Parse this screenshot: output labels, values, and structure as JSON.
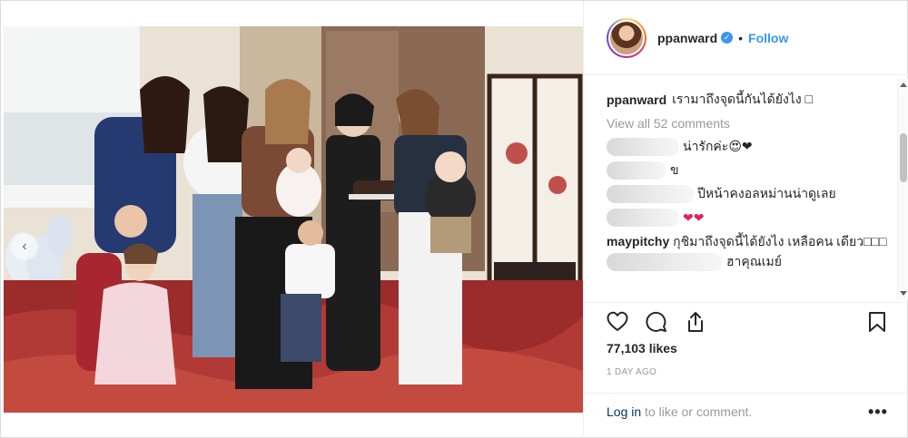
{
  "post": {
    "username": "ppanward",
    "verified_badge": "✓",
    "separator": "•",
    "follow_label": "Follow",
    "caption_user": "ppanward",
    "caption_text": "เรามาถึงจุดนี้กันได้ยังไง □",
    "view_all": "View all 52 comments",
    "comments": [
      {
        "user": "",
        "text": "น่ารักค่ะ😍❤"
      },
      {
        "user": "",
        "text": "ข"
      },
      {
        "user": "",
        "text": "ปีหน้าคงอลหม่านน่าดูเลย"
      },
      {
        "user": "",
        "text": "❤❤"
      },
      {
        "user": "maypitchy",
        "text": "กุชิมาถึงจุดนี้ได้ยังไง เหลือคน เดียว□□□"
      },
      {
        "user": "",
        "text": "ฮาคุณเมย์"
      }
    ],
    "likes": "77,103 likes",
    "timestamp": "1 DAY AGO",
    "login_link": "Log in",
    "login_rest": " to like or comment.",
    "more_label": "•••",
    "nav_prev": "‹"
  },
  "icons": {
    "like": "heart-icon",
    "comment": "comment-icon",
    "share": "share-icon",
    "save": "bookmark-icon",
    "verified": "verified-badge-icon"
  },
  "colors": {
    "link": "#3897f0",
    "muted": "#999999",
    "text": "#262626",
    "heart": "#e0245e"
  }
}
